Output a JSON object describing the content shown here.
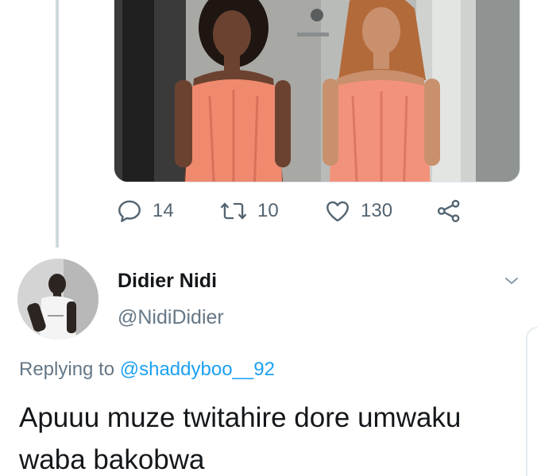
{
  "tweet_actions": {
    "reply_count": "14",
    "retweet_count": "10",
    "like_count": "130"
  },
  "reply_tweet": {
    "display_name": "Didier Nidi",
    "handle": "@NidiDidier",
    "replying_prefix": "Replying to",
    "replying_to": "@shaddyboo__92",
    "text": "Apuuu muze twitahire dore umwaku waba bakobwa"
  },
  "icons": [
    "reply-icon",
    "retweet-icon",
    "like-icon",
    "share-icon",
    "chevron-down-icon"
  ],
  "colors": {
    "accent": "#1da1f2",
    "muted_text": "#657786",
    "primary_text": "#14171a",
    "thread_line": "#cfd9de"
  }
}
